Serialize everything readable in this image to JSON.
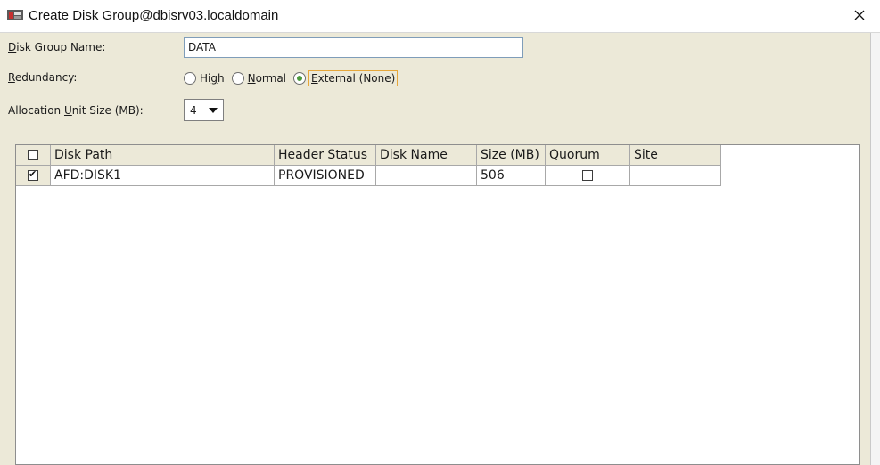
{
  "window": {
    "title": "Create Disk Group@dbisrv03.localdomain"
  },
  "form": {
    "disk_group_name": {
      "label_mnemonic": "D",
      "label_rest": "isk Group Name:",
      "value": "DATA"
    },
    "redundancy": {
      "label_mnemonic": "R",
      "label_rest": "edundancy:",
      "options": [
        {
          "pre": "Hi",
          "mnemonic": "g",
          "post": "h",
          "selected": false
        },
        {
          "pre": "",
          "mnemonic": "N",
          "post": "ormal",
          "selected": false
        },
        {
          "pre": "",
          "mnemonic": "E",
          "post": "xternal (None)",
          "selected": true
        }
      ]
    },
    "allocation_unit_size": {
      "label_pre": "Allocation ",
      "label_mnemonic": "U",
      "label_rest": "nit Size (MB):",
      "value": "4"
    }
  },
  "table": {
    "columns": [
      "Disk Path",
      "Header Status",
      "Disk Name",
      "Size (MB)",
      "Quorum",
      "Site"
    ],
    "rows": [
      {
        "selected": true,
        "disk_path": "AFD:DISK1",
        "header_status": "PROVISIONED",
        "disk_name": "",
        "size_mb": "506",
        "quorum": false,
        "site": ""
      }
    ]
  }
}
